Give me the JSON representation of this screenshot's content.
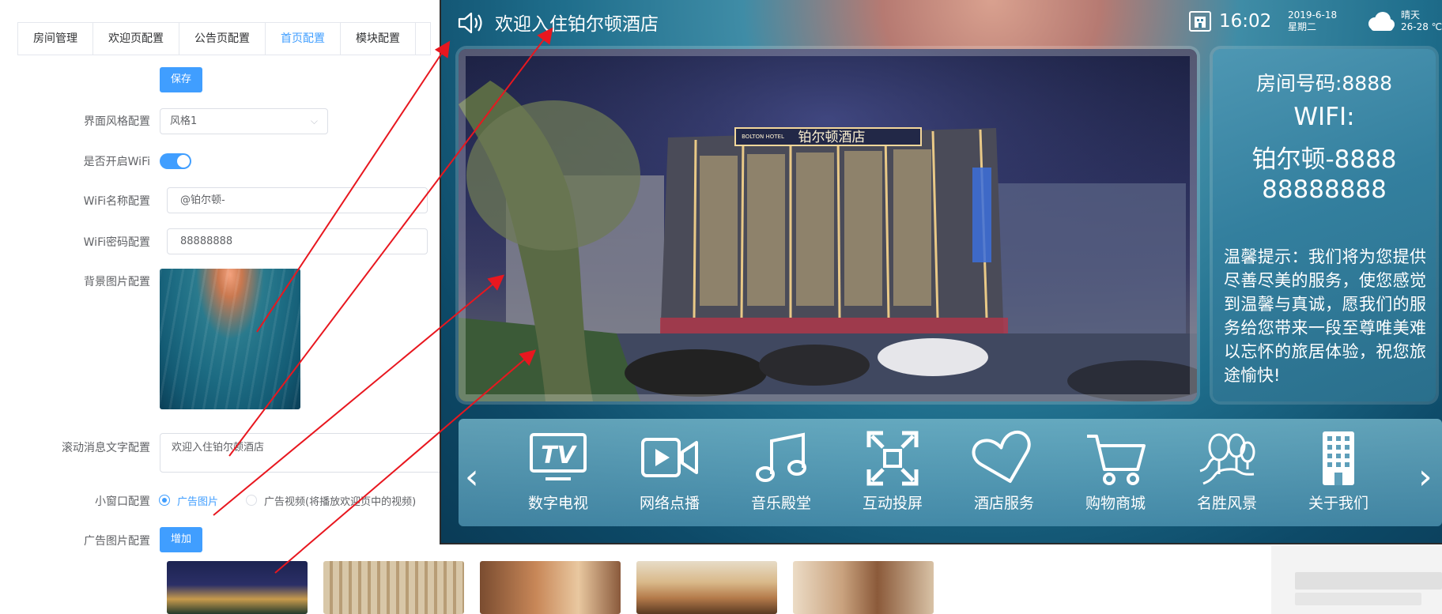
{
  "tabs": [
    {
      "label": "房间管理"
    },
    {
      "label": "欢迎页配置"
    },
    {
      "label": "公告页配置"
    },
    {
      "label": "首页配置"
    },
    {
      "label": "模块配置"
    }
  ],
  "active_tab": "首页配置",
  "form": {
    "save_label": "保存",
    "style_label": "界面风格配置",
    "style_value": "风格1",
    "wifi_on_label": "是否开启WiFi",
    "wifi_on": true,
    "wifi_name_label": "WiFi名称配置",
    "wifi_name_value": "@铂尔顿-",
    "wifi_pass_label": "WiFi密码配置",
    "wifi_pass_value": "88888888",
    "bg_label": "背景图片配置",
    "scroll_label": "滚动消息文字配置",
    "scroll_value": "欢迎入住铂尔顿酒店",
    "window_label": "小窗口配置",
    "radio_image": "广告图片",
    "radio_video": "广告视频(将播放欢迎页中的视频)",
    "ad_label": "广告图片配置",
    "add_label": "增加"
  },
  "tv": {
    "ticker": "欢迎入住铂尔顿酒店",
    "time": "16:02",
    "date": "2019-6-18",
    "weekday": "星期二",
    "weather": "晴天",
    "temp": "26-28 ℃",
    "room_no": "房间号码:8888",
    "wifi_label": "WIFI:",
    "wifi_name": "铂尔顿-8888",
    "wifi_pass": "88888888",
    "tip": "温馨提示：我们将为您提供尽善尽美的服务，使您感觉到温馨与真诚，愿我们的服务给您带来一段至尊唯美难以忘怀的旅居体验，祝您旅途愉快!",
    "hotel_sign": "铂尔顿酒店",
    "hotel_sign_en": "BOLTON HOTEL",
    "menu": [
      {
        "label": "数字电视",
        "icon": "tv-icon"
      },
      {
        "label": "网络点播",
        "icon": "video-camera-icon"
      },
      {
        "label": "音乐殿堂",
        "icon": "music-note-icon"
      },
      {
        "label": "互动投屏",
        "icon": "screen-cast-icon"
      },
      {
        "label": "酒店服务",
        "icon": "heart-icon"
      },
      {
        "label": "购物商城",
        "icon": "shopping-cart-icon"
      },
      {
        "label": "名胜风景",
        "icon": "scenery-icon"
      },
      {
        "label": "关于我们",
        "icon": "building-icon"
      }
    ]
  },
  "colors": {
    "primary": "#409eff",
    "arrow": "#e8171f"
  }
}
